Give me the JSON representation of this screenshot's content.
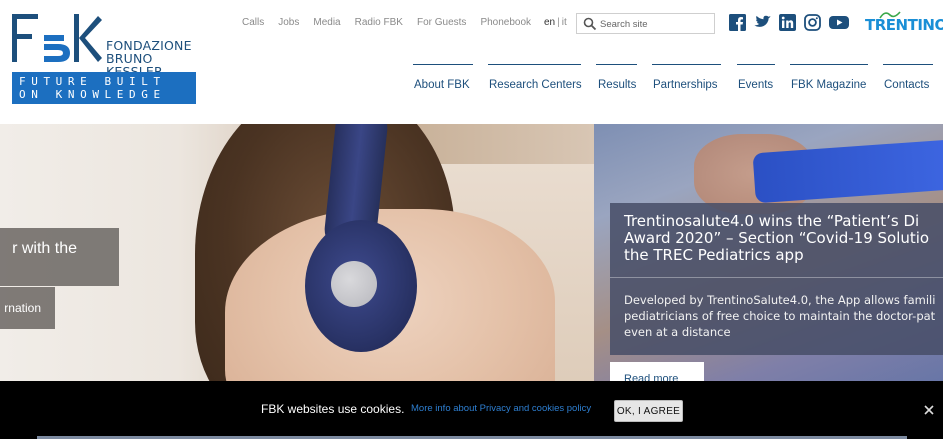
{
  "logo": {
    "line1": "FONDAZIONE",
    "line2": "BRUNO KESSLER",
    "tagline1": "FUTURE BUILT",
    "tagline2": "ON KNOWLEDGE",
    "brand_color": "#1c6fc0"
  },
  "utility_nav": [
    "Calls",
    "Jobs",
    "Media",
    "Radio FBK",
    "For Guests",
    "Phonebook"
  ],
  "language": {
    "active": "en",
    "separator": "|",
    "other": "it"
  },
  "search": {
    "placeholder": "Search site",
    "icon": "search-icon"
  },
  "social": [
    "facebook-icon",
    "twitter-icon",
    "linkedin-icon",
    "instagram-icon",
    "youtube-icon"
  ],
  "partner_logo": "TRENTINO",
  "main_nav": [
    "About FBK",
    "Research Centers",
    "Results",
    "Partnerships",
    "Events",
    "FBK Magazine",
    "Contacts"
  ],
  "hero": {
    "left_caption": "r with the",
    "left_link": "rnation",
    "news": {
      "title_lines": [
        "Trentinosalute4.0 wins the “Patient’s Di",
        "Award 2020” – Section “Covid-19 Solutio",
        "the TREC Pediatrics app"
      ],
      "body_lines": [
        "Developed by TrentinoSalute4.0, the App allows famili",
        "pediatricians of free choice to maintain the doctor-pat",
        "even at a distance"
      ],
      "read_more": "Read more"
    }
  },
  "cookie": {
    "text": "FBK websites use cookies.",
    "link": "More info about Privacy and cookies policy",
    "button": "OK, I AGREE",
    "close_icon": "close-icon"
  }
}
